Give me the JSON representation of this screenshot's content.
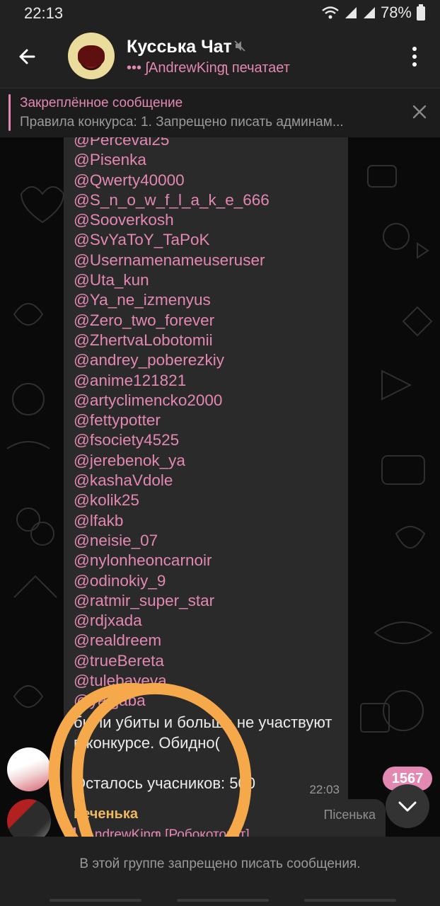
{
  "status": {
    "time": "22:13",
    "battery": "78%"
  },
  "header": {
    "title": "Кусська Чат",
    "subtitle": "••• ʃAndrewKingʅ печатает"
  },
  "pinned": {
    "title": "Закреплённое сообщение",
    "text": "Правила конкурса:  1. Запрещено писать админам..."
  },
  "message": {
    "users": [
      "@Perceval25",
      "@Pisenka",
      "@Qwerty40000",
      "@S_n_o_w_f_l_a_k_e_666",
      "@Sooverkosh",
      "@SvYaToY_TaPoK",
      "@Usernamenameuseruser",
      "@Uta_kun",
      "@Ya_ne_izmenyus",
      "@Zero_two_forever",
      "@ZhertvaLobotomii",
      "@andrey_poberezkiy",
      "@anime121821",
      "@artyclimencko2000",
      "@fettypotter",
      "@fsociety4525",
      "@jerebenok_ya",
      "@kashaVdole",
      "@kolik25",
      "@lfakb",
      "@neisie_07",
      "@nylonheoncarnoir",
      "@odinokiy_9",
      "@ratmir_super_star",
      "@rdjxada",
      "@realdreem",
      "@trueBereta",
      "@tulebayeva",
      "@ya_jaba"
    ],
    "text": "были убиты и больше не участвуют в конкурсе. Обидно(",
    "remaining": "Осталось учасников: 500",
    "time": "22:03"
  },
  "next_message": {
    "sender": "печенька",
    "role": "Пiсенька",
    "reply_preview": "ʃAndrewKingʅ [Робокотокот]"
  },
  "unread_count": "1567",
  "footer": {
    "restricted_text": "В этой группе запрещено писать сообщения."
  },
  "colors": {
    "accent": "#e387b3",
    "annotation": "#f5a94a",
    "sender_name": "#f0b95f"
  }
}
